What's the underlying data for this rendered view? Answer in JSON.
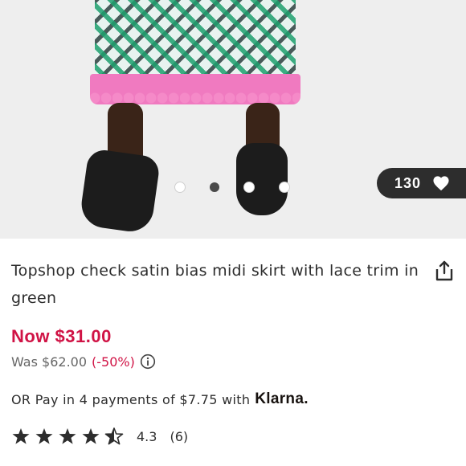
{
  "product": {
    "likes_count": "130",
    "title": "Topshop check satin bias midi skirt with lace trim in green",
    "price_now": "Now $31.00",
    "price_was": "Was $62.00",
    "discount": "(-50%)",
    "payment_prefix": "OR Pay in 4 payments of $7.75 with",
    "payment_provider": "Klarna.",
    "rating_value": "4.3",
    "rating_count": "(6)",
    "rating_stars": 4.3
  },
  "gallery": {
    "image_count": 4,
    "active_index": 1
  },
  "icons": {
    "likes": "heart-icon",
    "share": "share-icon",
    "info": "info-icon",
    "rating": "star-icon"
  },
  "colors": {
    "sale_red": "#d01345",
    "dark": "#2d2d2d",
    "muted": "#666666"
  }
}
